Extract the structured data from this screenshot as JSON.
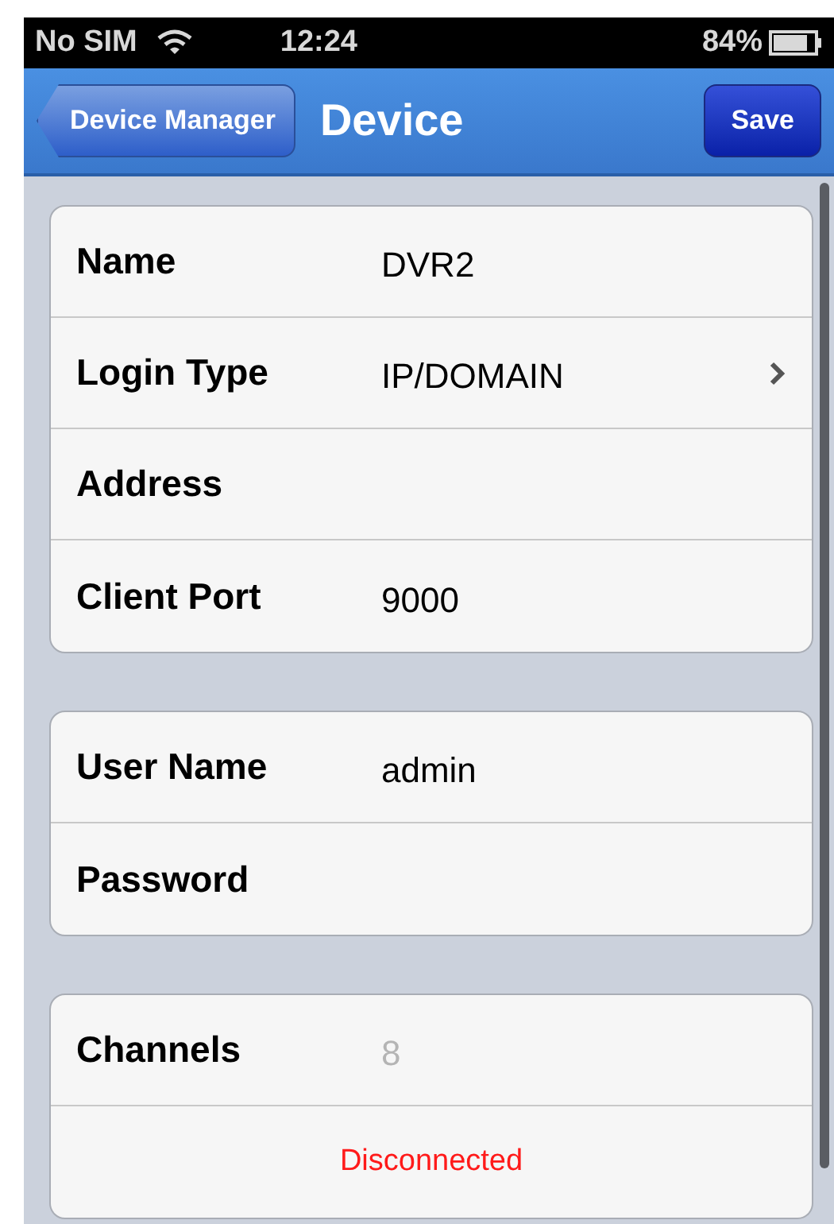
{
  "status_bar": {
    "carrier": "No SIM",
    "time": "12:24",
    "battery": "84%"
  },
  "nav_bar": {
    "back": "Device Manager",
    "title": "Device",
    "action": "Save"
  },
  "groups": [
    {
      "rows": [
        {
          "kind": "field",
          "label": "Name",
          "value": "DVR2"
        },
        {
          "kind": "select",
          "label": "Login Type",
          "value": "IP/DOMAIN"
        },
        {
          "kind": "field",
          "label": "Address"
        },
        {
          "kind": "field",
          "label": "Client Port",
          "value": "9000"
        }
      ]
    },
    {
      "rows": [
        {
          "kind": "field",
          "label": "User Name",
          "value": "admin"
        },
        {
          "kind": "field",
          "label": "Password"
        }
      ]
    },
    {
      "rows": [
        {
          "kind": "readonly",
          "label": "Channels",
          "value": "8"
        },
        {
          "kind": "status",
          "value": "Disconnected"
        }
      ]
    }
  ]
}
